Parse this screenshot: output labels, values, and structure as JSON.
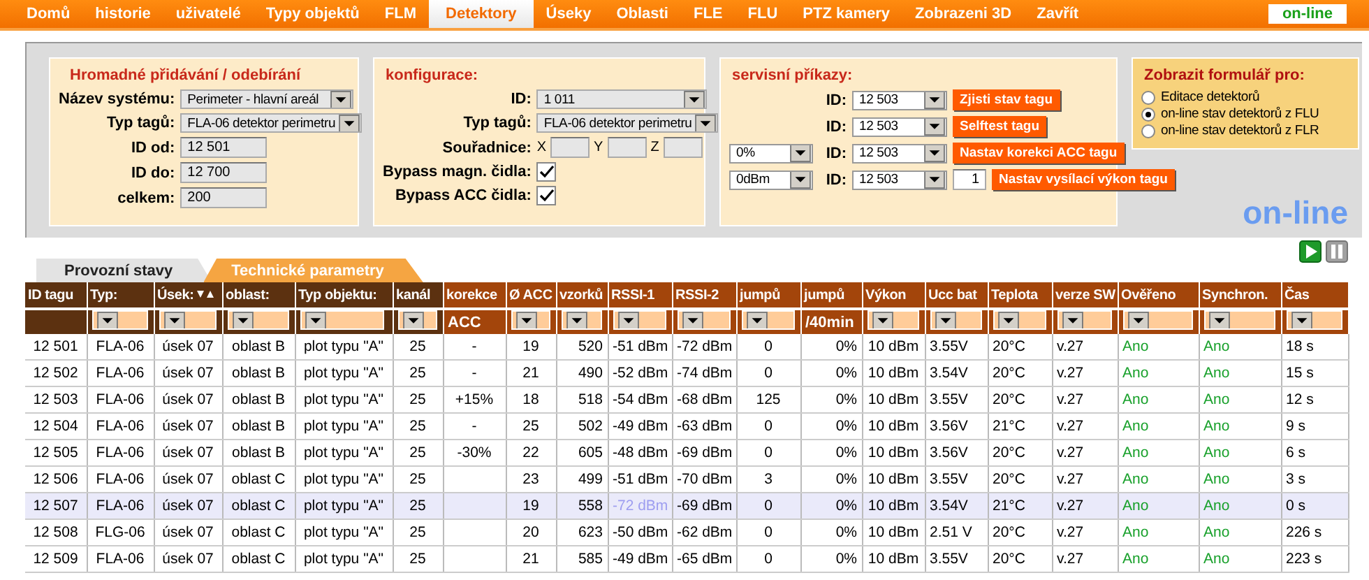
{
  "nav": {
    "items": [
      {
        "label": "Domů",
        "selected": false
      },
      {
        "label": "historie",
        "selected": false
      },
      {
        "label": "uživatelé",
        "selected": false
      },
      {
        "label": "Typy objektů",
        "selected": false
      },
      {
        "label": "FLM",
        "selected": false
      },
      {
        "label": "Detektory",
        "selected": true
      },
      {
        "label": "Úseky",
        "selected": false
      },
      {
        "label": "Oblasti",
        "selected": false
      },
      {
        "label": "FLE",
        "selected": false
      },
      {
        "label": "FLU",
        "selected": false
      },
      {
        "label": "PTZ kamery",
        "selected": false
      },
      {
        "label": "Zobrazeni 3D",
        "selected": false
      },
      {
        "label": "Zavřít",
        "selected": false
      }
    ],
    "status": "on-line"
  },
  "bulk": {
    "title": "Hromadné přidávání / odebírání",
    "fields": [
      {
        "label": "Název systému:",
        "kind": "select",
        "value": "Perimeter - hlavní areál"
      },
      {
        "label": "Typ tagů:",
        "kind": "select",
        "value": "FLA-06 detektor perimetru"
      },
      {
        "label": "ID od:",
        "kind": "input",
        "value": "12 501"
      },
      {
        "label": "ID do:",
        "kind": "input",
        "value": "12 700"
      },
      {
        "label": "celkem:",
        "kind": "input",
        "value": "200"
      }
    ]
  },
  "config": {
    "title": "konfigurace:",
    "id": {
      "label": "ID:",
      "value": "1 011"
    },
    "tag_type": {
      "label": "Typ tagů:",
      "value": "FLA-06 detektor perimetru"
    },
    "coords": {
      "label": "Souřadnice:",
      "axes": [
        "X",
        "Y",
        "Z"
      ]
    },
    "checks": [
      {
        "label": "Bypass magn. čidla:",
        "checked": true
      },
      {
        "label": "Bypass ACC čidla:",
        "checked": true
      }
    ]
  },
  "service": {
    "title": "servisní příkazy:",
    "rows": [
      {
        "id_label": "ID:",
        "id": "12 503",
        "button": "Zjisti stav tagu"
      },
      {
        "id_label": "ID:",
        "id": "12 503",
        "button": "Selftest tagu"
      },
      {
        "option": "0%",
        "id_label": "ID:",
        "id": "12 503",
        "button": "Nastav korekci ACC tagu"
      },
      {
        "option": "0dBm",
        "id_label": "ID:",
        "id": "12 503",
        "count": "1",
        "button": "Nastav vysílací výkon tagu"
      }
    ]
  },
  "form_choice": {
    "title": "Zobrazit formulář pro:",
    "options": [
      {
        "label": "Editace detektorů",
        "selected": false
      },
      {
        "label": "on-line stav detektorů z FLU",
        "selected": true
      },
      {
        "label": "on-line stav detektorů z FLR",
        "selected": false
      }
    ]
  },
  "mode_label": "on-line",
  "tabs": [
    {
      "label": "Provozní stavy",
      "selected": false
    },
    {
      "label": "Technické parametry",
      "selected": true
    }
  ],
  "table": {
    "columns": [
      {
        "label": "ID tagu",
        "color": "#5c3110",
        "filter_dropdown": false,
        "sorted": false
      },
      {
        "label": "Typ:",
        "color": "#5c3110",
        "filter_dropdown": true,
        "sorted": false
      },
      {
        "label": "Úsek:",
        "color": "#5c3110",
        "filter_dropdown": true,
        "sorted": true
      },
      {
        "label": "oblast:",
        "color": "#5c3110",
        "filter_dropdown": true,
        "sorted": false
      },
      {
        "label": "Typ objektu:",
        "color": "#5c3110",
        "filter_dropdown": true,
        "sorted": false
      },
      {
        "label": "kanál",
        "color": "#5c3110",
        "filter_dropdown": true,
        "sorted": false
      },
      {
        "label": "korekce",
        "color": "#a3450b",
        "filter_text": "ACC",
        "sorted": false
      },
      {
        "label": "Ø ACC",
        "color": "#a3450b",
        "filter_dropdown": true,
        "sorted": false
      },
      {
        "label": "vzorků",
        "color": "#a3450b",
        "filter_dropdown": true,
        "sorted": false
      },
      {
        "label": "RSSI-1",
        "color": "#a3450b",
        "filter_dropdown": true,
        "sorted": false
      },
      {
        "label": "RSSI-2",
        "color": "#a3450b",
        "filter_dropdown": true,
        "sorted": false
      },
      {
        "label": "jumpů",
        "color": "#a3450b",
        "filter_dropdown": true,
        "sorted": false
      },
      {
        "label": "jumpů",
        "color": "#a3450b",
        "filter_text": "/40min",
        "sorted": false
      },
      {
        "label": "Výkon",
        "color": "#a3450b",
        "filter_dropdown": true,
        "sorted": false
      },
      {
        "label": "Ucc bat",
        "color": "#a3450b",
        "filter_dropdown": true,
        "sorted": false
      },
      {
        "label": "Teplota",
        "color": "#a3450b",
        "filter_dropdown": true,
        "sorted": false
      },
      {
        "label": "verze SW",
        "color": "#a3450b",
        "filter_dropdown": true,
        "sorted": false
      },
      {
        "label": "Ověřeno",
        "color": "#a3450b",
        "filter_dropdown": true,
        "sorted": false
      },
      {
        "label": "Synchron.",
        "color": "#a3450b",
        "filter_dropdown": true,
        "sorted": false
      },
      {
        "label": "Čas",
        "color": "#a3450b",
        "filter_dropdown": true,
        "sorted": false
      }
    ],
    "rows": [
      {
        "selected": false,
        "cells": [
          "12 501",
          "FLA-06",
          "úsek 07",
          "oblast B",
          "plot typu \"A\"",
          "25",
          "-",
          "19",
          "520",
          "-51 dBm",
          "-72 dBm",
          "0",
          "0%",
          "10 dBm",
          "3.55V",
          "20°C",
          "v.27",
          {
            "text": "Ano",
            "color": "#17a02a"
          },
          {
            "text": "Ano",
            "color": "#17a02a"
          },
          "18 s"
        ]
      },
      {
        "selected": false,
        "cells": [
          "12 502",
          "FLA-06",
          "úsek 07",
          "oblast B",
          "plot typu \"A\"",
          "25",
          "-",
          "21",
          "490",
          "-52 dBm",
          "-74 dBm",
          "0",
          "0%",
          "10 dBm",
          "3.54V",
          "20°C",
          "v.27",
          {
            "text": "Ano",
            "color": "#17a02a"
          },
          {
            "text": "Ano",
            "color": "#17a02a"
          },
          "15 s"
        ]
      },
      {
        "selected": false,
        "cells": [
          "12 503",
          "FLA-06",
          "úsek 07",
          "oblast B",
          "plot typu \"A\"",
          "25",
          "+15%",
          "18",
          "518",
          "-54 dBm",
          "-68 dBm",
          "125",
          "0%",
          "10 dBm",
          "3.55V",
          "20°C",
          "v.27",
          {
            "text": "Ano",
            "color": "#17a02a"
          },
          {
            "text": "Ano",
            "color": "#17a02a"
          },
          "12 s"
        ]
      },
      {
        "selected": false,
        "cells": [
          "12 504",
          "FLA-06",
          "úsek 07",
          "oblast B",
          "plot typu \"A\"",
          "25",
          "-",
          "25",
          "502",
          "-49 dBm",
          "-63 dBm",
          "0",
          "0%",
          "10 dBm",
          "3.56V",
          "21°C",
          "v.27",
          {
            "text": "Ano",
            "color": "#17a02a"
          },
          {
            "text": "Ano",
            "color": "#17a02a"
          },
          "9 s"
        ]
      },
      {
        "selected": false,
        "cells": [
          "12 505",
          "FLA-06",
          "úsek 07",
          "oblast B",
          "plot typu \"A\"",
          "25",
          "-30%",
          "22",
          "605",
          "-48 dBm",
          "-69 dBm",
          "0",
          "0%",
          "10 dBm",
          "3.56V",
          "20°C",
          "v.27",
          {
            "text": "Ano",
            "color": "#17a02a"
          },
          {
            "text": "Ano",
            "color": "#17a02a"
          },
          "6 s"
        ]
      },
      {
        "selected": false,
        "cells": [
          "12 506",
          "FLA-06",
          "úsek 07",
          "oblast C",
          "plot typu \"A\"",
          "25",
          "",
          "23",
          "499",
          "-51 dBm",
          "-70 dBm",
          "3",
          "0%",
          "10 dBm",
          "3.55V",
          "20°C",
          "v.27",
          {
            "text": "Ano",
            "color": "#17a02a"
          },
          {
            "text": "Ano",
            "color": "#17a02a"
          },
          "3 s"
        ]
      },
      {
        "selected": true,
        "cells": [
          "12 507",
          "FLA-06",
          "úsek 07",
          "oblast C",
          "plot typu \"A\"",
          "25",
          "",
          "19",
          "558",
          {
            "text": "-72 dBm",
            "faded": true
          },
          "-69 dBm",
          "0",
          "0%",
          "10 dBm",
          "3.54V",
          "21°C",
          "v.27",
          {
            "text": "Ano",
            "color": "#17a02a"
          },
          {
            "text": "Ano",
            "color": "#17a02a"
          },
          "0 s"
        ]
      },
      {
        "selected": false,
        "cells": [
          "12 508",
          "FLG-06",
          "úsek 07",
          "oblast C",
          "plot typu \"A\"",
          "25",
          "",
          "20",
          "623",
          "-50 dBm",
          "-62 dBm",
          "0",
          "0%",
          "10 dBm",
          "2.51 V",
          "20°C",
          "v.27",
          {
            "text": "Ano",
            "color": "#17a02a"
          },
          {
            "text": "Ano",
            "color": "#17a02a"
          },
          "226 s"
        ]
      },
      {
        "selected": false,
        "cells": [
          "12 509",
          "FLA-06",
          "úsek 07",
          "oblast C",
          "plot typu \"A\"",
          "25",
          "",
          "21",
          "585",
          "-49 dBm",
          "-65 dBm",
          "0",
          "0%",
          "10 dBm",
          "3.55V",
          "20°C",
          "v.27",
          {
            "text": "Ano",
            "color": "#17a02a"
          },
          {
            "text": "Ano",
            "color": "#17a02a"
          },
          "223 s"
        ]
      }
    ]
  }
}
